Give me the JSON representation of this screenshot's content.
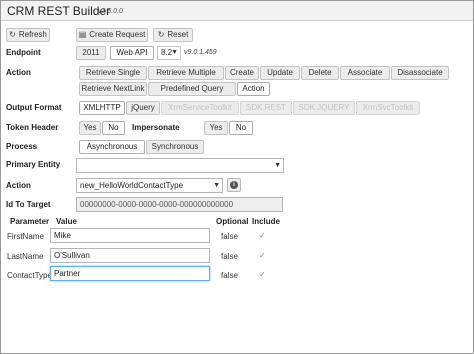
{
  "app": {
    "title": "CRM REST Builder",
    "version": "v2.5.0.0"
  },
  "toolbar": {
    "refresh": "Refresh",
    "create_request": "Create Request",
    "reset": "Reset"
  },
  "endpoint": {
    "label": "Endpoint",
    "btn_2011": "2011",
    "btn_webapi": "Web API",
    "version_select": "8.2",
    "version_text": "v9.0.1.459"
  },
  "action": {
    "label": "Action",
    "buttons": [
      "Retrieve Single",
      "Retrieve Multiple",
      "Create",
      "Update",
      "Delete",
      "Associate",
      "Disassociate",
      "Retrieve NextLink",
      "Predefined Query",
      "Action"
    ]
  },
  "output_format": {
    "label": "Output Format",
    "buttons": [
      "XMLHTTP",
      "jQuery",
      "XrmServiceToolkit",
      "SDK.REST",
      "SDK.JQUERY",
      "XrmSvcToolkit"
    ]
  },
  "token_header": {
    "label": "Token Header",
    "yes": "Yes",
    "no": "No"
  },
  "impersonate": {
    "label": "Impersonate",
    "yes": "Yes",
    "no": "No"
  },
  "process": {
    "label": "Process",
    "async": "Asynchronous",
    "sync": "Synchronous"
  },
  "primary_entity": {
    "label": "Primary Entity",
    "value": ""
  },
  "action_select": {
    "label": "Action",
    "value": "new_HelloWorldContactType"
  },
  "id_to_target": {
    "label": "Id To Target",
    "value": "00000000-0000-0000-0000-000000000000"
  },
  "params": {
    "headers": {
      "parameter": "Parameter",
      "value": "Value",
      "optional": "Optional",
      "include": "Include"
    },
    "rows": [
      {
        "name": "FirstName",
        "value": "Mike",
        "optional": "false"
      },
      {
        "name": "LastName",
        "value": "O'Sullivan",
        "optional": "false"
      },
      {
        "name": "ContactType",
        "value": "Partner",
        "optional": "false"
      }
    ]
  },
  "icons": {
    "refresh": "refresh-icon",
    "create": "document-icon",
    "reset": "refresh-icon",
    "info": "info-icon",
    "check": "check-icon"
  },
  "colors": {
    "focus": "#66afe9",
    "button_bg": "#ececec",
    "active_bg": "#ffffff"
  }
}
